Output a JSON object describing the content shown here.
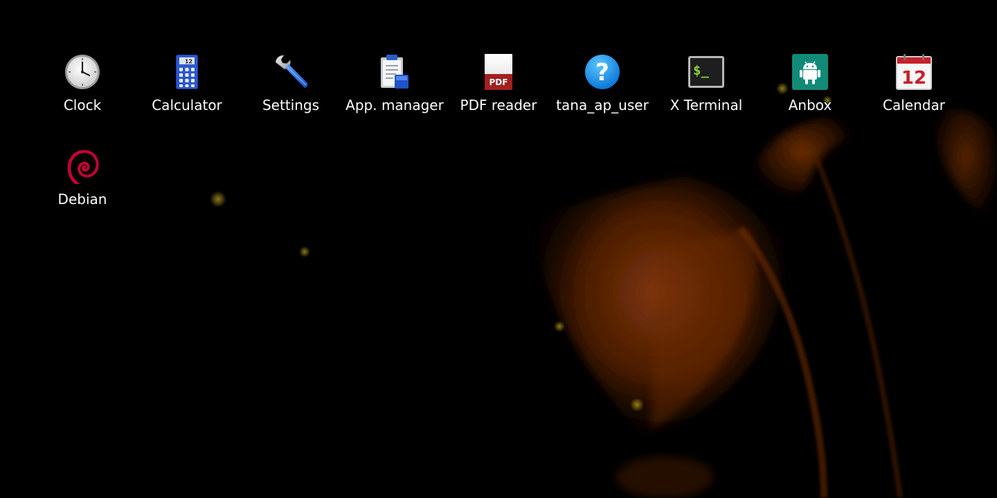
{
  "desktop": {
    "background_color": "#000000",
    "wallpaper_accent": "#b84a10",
    "icons": [
      {
        "label": "Clock",
        "icon": "clock-icon"
      },
      {
        "label": "Calculator",
        "icon": "calculator-icon"
      },
      {
        "label": "Settings",
        "icon": "wrench-icon"
      },
      {
        "label": "App. manager",
        "icon": "clipboard-icon"
      },
      {
        "label": "PDF reader",
        "icon": "pdf-icon"
      },
      {
        "label": "tana_ap_user",
        "icon": "help-icon"
      },
      {
        "label": "X Terminal",
        "icon": "terminal-icon"
      },
      {
        "label": "Anbox",
        "icon": "android-icon"
      },
      {
        "label": "Calendar",
        "icon": "calendar-icon"
      },
      {
        "label": "Debian",
        "icon": "debian-swirl-icon"
      }
    ],
    "calculator_display": "12",
    "calendar_day": "12",
    "pdf_badge": "PDF",
    "help_glyph": "?",
    "terminal_prompt": "$_"
  }
}
